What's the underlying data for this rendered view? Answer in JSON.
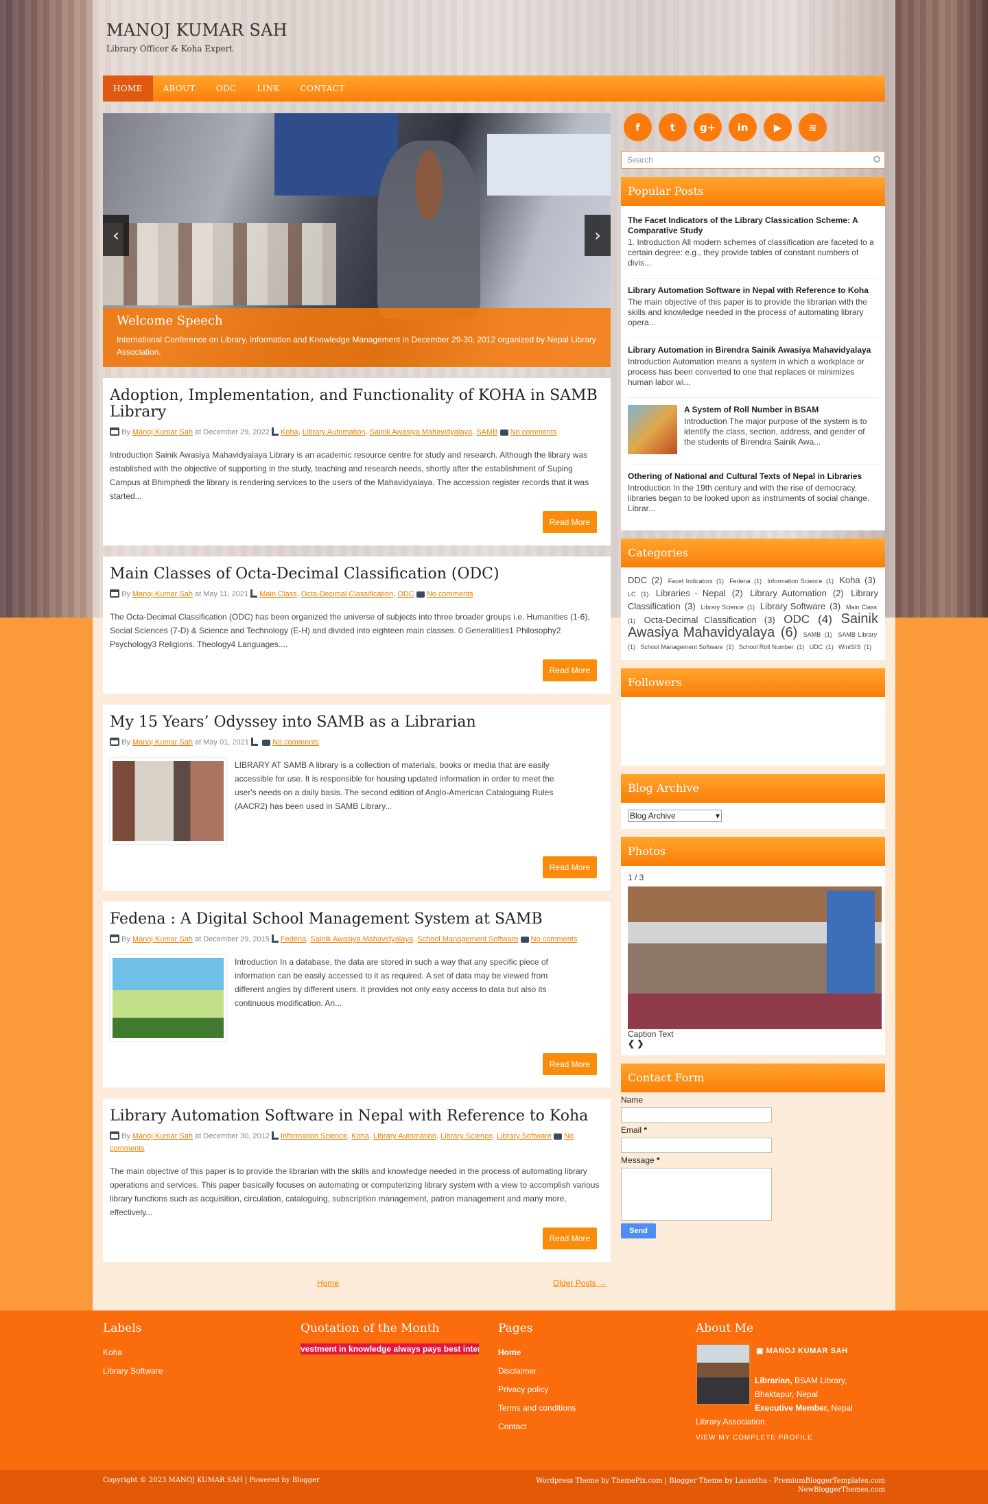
{
  "site": {
    "title": "MANOJ KUMAR SAH",
    "description": "Library Officer & Koha Expert"
  },
  "nav": [
    "HOME",
    "ABOUT",
    "ODC",
    "LINK",
    "CONTACT"
  ],
  "slider": {
    "caption_title": "Welcome Speech",
    "caption_text": "International Conference on Library, Information and Knowledge Management in December 29-30, 2012 organized by Nepal Library Association.",
    "prev": "‹",
    "next": "›"
  },
  "posts": [
    {
      "title": "Adoption, Implementation, and Functionality of KOHA in SAMB Library",
      "by": "By",
      "author": "Manoj Kumar Sah",
      "at": "at December 29, 2022",
      "labels": [
        "Koha",
        "Library Automation",
        "Sainik Awasiya Mahavidyalaya",
        "SAMB"
      ],
      "comments": "No comments",
      "excerpt": " Introduction Sainik Awasiya Mahavidyalaya Library is an academic resource centre for study and research. Although the library was established with the objective of supporting in the study, teaching and research needs, shortly after the establishment of Suping Campus at Bhimphedi the library is rendering services to the users of the Mahavidyalaya. The accession register records that it was started...",
      "read_more": "Read More"
    },
    {
      "title": "Main Classes of Octa-Decimal Classification (ODC)",
      "by": "By",
      "author": "Manoj Kumar Sah",
      "at": "at May 11, 2021",
      "labels": [
        "Main Class",
        "Octa-Decimal Classification",
        "ODC"
      ],
      "comments": "No comments",
      "excerpt": "The Octa-Decimal Classification (ODC) has been organized the universe of subjects into three broader groups i.e. Humanities (1-6), Social Sciences (7-D) & Science and Technology (E-H) and divided into eighteen main classes. 0    Generalities1    Philosophy2    Psychology3    Religions. Theology4    Languages....",
      "read_more": "Read More"
    },
    {
      "title": "My 15 Years’ Odyssey into SAMB as a Librarian",
      "by": "By",
      "author": "Manoj Kumar Sah",
      "at": "at May 01, 2021",
      "labels": [],
      "comments": "No comments",
      "excerpt": "LIBRARY AT SAMB A library is a collection of materials, books or media that are easily accessible for use. It is responsible for housing updated information in order to meet the user's needs on a daily basis. The second edition of Anglo-American Cataloguing Rules (AACR2) has been used in SAMB Library...",
      "read_more": "Read More"
    },
    {
      "title": "Fedena : A Digital School Management System at SAMB",
      "by": "By",
      "author": "Manoj Kumar Sah",
      "at": "at December 29, 2015",
      "labels": [
        "Fedena",
        "Sainik Awasiya Mahavidyalaya",
        "School Management Software"
      ],
      "comments": "No comments",
      "excerpt": "Introduction In a database, the data are stored in such a way that any specific piece of information can be easily accessed to it as required. A set of data may be viewed from different angles by different users. It provides not only easy access to data but also its continuous modification. An...",
      "read_more": "Read More"
    },
    {
      "title": "Library Automation Software in Nepal with Reference to Koha",
      "by": "By",
      "author": "Manoj Kumar Sah",
      "at": "at December 30, 2012",
      "labels": [
        "Information Science",
        "Koha",
        "Library Automation",
        "Library Science",
        "Library Software"
      ],
      "comments": "No comments",
      "excerpt": "The main objective of this paper is to provide the librarian with the skills and knowledge needed in the process of automating library operations and services. This paper basically focuses on automating or computerizing library system with a view to accomplish various library functions such as acquisition, circulation, cataloguing, subscription management, patron management and many more, effectively...",
      "read_more": "Read More"
    }
  ],
  "pager": {
    "home": "Home",
    "older": "Older Posts →"
  },
  "social": [
    {
      "icon": "facebook-icon",
      "glyph": "f"
    },
    {
      "icon": "twitter-icon",
      "glyph": "t"
    },
    {
      "icon": "google-plus-icon",
      "glyph": "g+"
    },
    {
      "icon": "linkedin-icon",
      "glyph": "in"
    },
    {
      "icon": "youtube-icon",
      "glyph": "▶"
    },
    {
      "icon": "rss-icon",
      "glyph": "≋"
    }
  ],
  "search": {
    "placeholder": "Search"
  },
  "popular": {
    "title": "Popular Posts",
    "items": [
      {
        "title": "The Facet Indicators of the Library Classication Scheme: A Comparative Study",
        "text": "1. Introduction All modern schemes of classification are faceted to a certain degree: e.g., they provide tables of constant numbers of divis..."
      },
      {
        "title": "Library Automation Software in Nepal with Reference to Koha",
        "text": "The main objective of this paper is to provide the librarian with the skills and knowledge needed in the process of automating library opera..."
      },
      {
        "title": "Library Automation in Birendra Sainik Awasiya Mahavidyalaya",
        "text": "Introduction   Automation means a system in which a workplace or process has been converted to one that replaces or minimizes human labor wi..."
      },
      {
        "title": "A System of Roll Number in BSAM",
        "text": "Introduction   The major purpose of the system is to identify the class, section, address, and gender of the students of Birendra Sainik Awa..."
      },
      {
        "title": "Othering of National and Cultural Texts of Nepal in Libraries",
        "text": "Introduction   In the 19th century and with the rise of democracy, libraries began to be looked upon as instruments of social change. Librar..."
      }
    ]
  },
  "categories": {
    "title": "Categories",
    "items": [
      {
        "name": "DDC",
        "count": "(2)",
        "size": 13
      },
      {
        "name": "Facet Indicators",
        "count": "(1)",
        "size": 9
      },
      {
        "name": "Fedena",
        "count": "(1)",
        "size": 9
      },
      {
        "name": "Information Science",
        "count": "(1)",
        "size": 9
      },
      {
        "name": "Koha",
        "count": "(3)",
        "size": 13
      },
      {
        "name": "LC",
        "count": "(1)",
        "size": 9
      },
      {
        "name": "Libraries - Nepal",
        "count": "(2)",
        "size": 13
      },
      {
        "name": "Library Automation",
        "count": "(2)",
        "size": 13
      },
      {
        "name": "Library Classification",
        "count": "(3)",
        "size": 13
      },
      {
        "name": "Library Science",
        "count": "(1)",
        "size": 9
      },
      {
        "name": "Library Software",
        "count": "(3)",
        "size": 13
      },
      {
        "name": "Main Class",
        "count": "(1)",
        "size": 9
      },
      {
        "name": "Octa-Decimal Classification",
        "count": "(3)",
        "size": 13
      },
      {
        "name": "ODC",
        "count": "(4)",
        "size": 17
      },
      {
        "name": "Sainik Awasiya Mahavidyalaya",
        "count": "(6)",
        "size": 20
      },
      {
        "name": "SAMB",
        "count": "(1)",
        "size": 9
      },
      {
        "name": "SAMB Library",
        "count": "(1)",
        "size": 9
      },
      {
        "name": "School Management Software",
        "count": "(1)",
        "size": 9
      },
      {
        "name": "School Roll Number",
        "count": "(1)",
        "size": 9
      },
      {
        "name": "UDC",
        "count": "(1)",
        "size": 9
      },
      {
        "name": "WinISIS",
        "count": "(1)",
        "size": 9
      }
    ]
  },
  "followers": {
    "title": "Followers"
  },
  "archive": {
    "title": "Blog Archive",
    "selected": "Blog Archive"
  },
  "photos": {
    "title": "Photos",
    "counter": "1 / 3",
    "caption": "Caption Text",
    "prev": "❮",
    "next": "❯"
  },
  "contact": {
    "title": "Contact Form",
    "name_label": "Name",
    "email_label": "Email",
    "message_label": "Message",
    "required": "*",
    "send": "Send"
  },
  "footer": {
    "labels": {
      "title": "Labels",
      "items": [
        "Koha",
        "Library Software"
      ]
    },
    "quote": {
      "title": "Quotation of the Month",
      "text": "vestment in knowledge always pays best inter"
    },
    "pages": {
      "title": "Pages",
      "items": [
        "Home",
        "Disclaimer",
        "Privacy policy",
        "Terms and conditions",
        "Contact"
      ]
    },
    "about": {
      "title": "About Me",
      "name": "MANOJ KUMAR SAH",
      "role1": "Librarian,",
      "role1_rest": " BSAM Library, Bhaktapur, Nepal",
      "role2": "Executive Member,",
      "role2_rest": " Nepal Library Association",
      "view_profile": "VIEW MY COMPLETE PROFILE"
    }
  },
  "bottom": {
    "copyright": "Copyright © 2023 MANOJ KUMAR SAH | Powered by Blogger",
    "credit1": "Wordpress Theme by ThemePix.com | Blogger Theme by Lasantha - PremiumBloggerTemplates.com",
    "credit2": "NewBloggerThemes.com"
  }
}
